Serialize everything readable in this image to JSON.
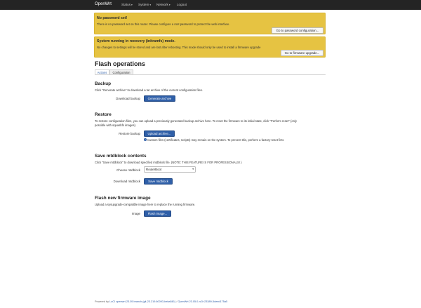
{
  "nav": {
    "brand": "OpenWrt",
    "items": [
      {
        "label": "Status",
        "has_dropdown": true
      },
      {
        "label": "System",
        "has_dropdown": true
      },
      {
        "label": "Network",
        "has_dropdown": true
      },
      {
        "label": "Logout",
        "has_dropdown": false
      }
    ]
  },
  "alerts": [
    {
      "title": "No password set!",
      "text": "There is no password set on this router. Please configure a root password to protect the web interface.",
      "button": "Go to password configuration..."
    },
    {
      "title": "System running in recovery (initramfs) mode.",
      "text": "No changes to settings will be stored and are lost after rebooting. This mode should only be used to install a firmware upgrade",
      "button": "Go to firmware upgrade..."
    }
  ],
  "page": {
    "title": "Flash operations",
    "tabs": [
      {
        "label": "Actions",
        "active": true
      },
      {
        "label": "Configuration",
        "active": false
      }
    ]
  },
  "backup": {
    "title": "Backup",
    "desc": "Click \"Generate archive\" to download a tar archive of the current configuration files.",
    "label": "Download backup",
    "button": "Generate archive"
  },
  "restore": {
    "title": "Restore",
    "desc1": "To restore configuration files, you can upload a previously generated backup archive here. To reset the firmware to its initial state, click \"Perform reset\" (only",
    "desc2": "possible with squashfs images).",
    "label": "Restore backup",
    "button": "Upload archive...",
    "hint": "Custom files (certificates, scripts) may remain on the system. To prevent this, perform a factory-reset first."
  },
  "mtd": {
    "title": "Save mtdblock contents",
    "desc": "Click \"Save mtdblock\" to download specified mtdblock file. (NOTE: THIS FEATURE IS FOR PROFESSIONALS! )",
    "choose_label": "Choose mtdblock",
    "selected": "RouterBoot",
    "download_label": "Download mtdblock",
    "button": "Save mtdblock"
  },
  "flash": {
    "title": "Flash new firmware image",
    "desc": "Upload a sysupgrade-compatible image here to replace the running firmware.",
    "label": "Image",
    "button": "Flash image..."
  },
  "footer": {
    "prefix": "Powered by",
    "luci": "LuCI openwrt-23.05 branch (git-23.219.60093-beba581)",
    "separator": " / ",
    "openwrt": "OpenWrt 23.05.0-rc3 r23389-5deed175a5"
  }
}
